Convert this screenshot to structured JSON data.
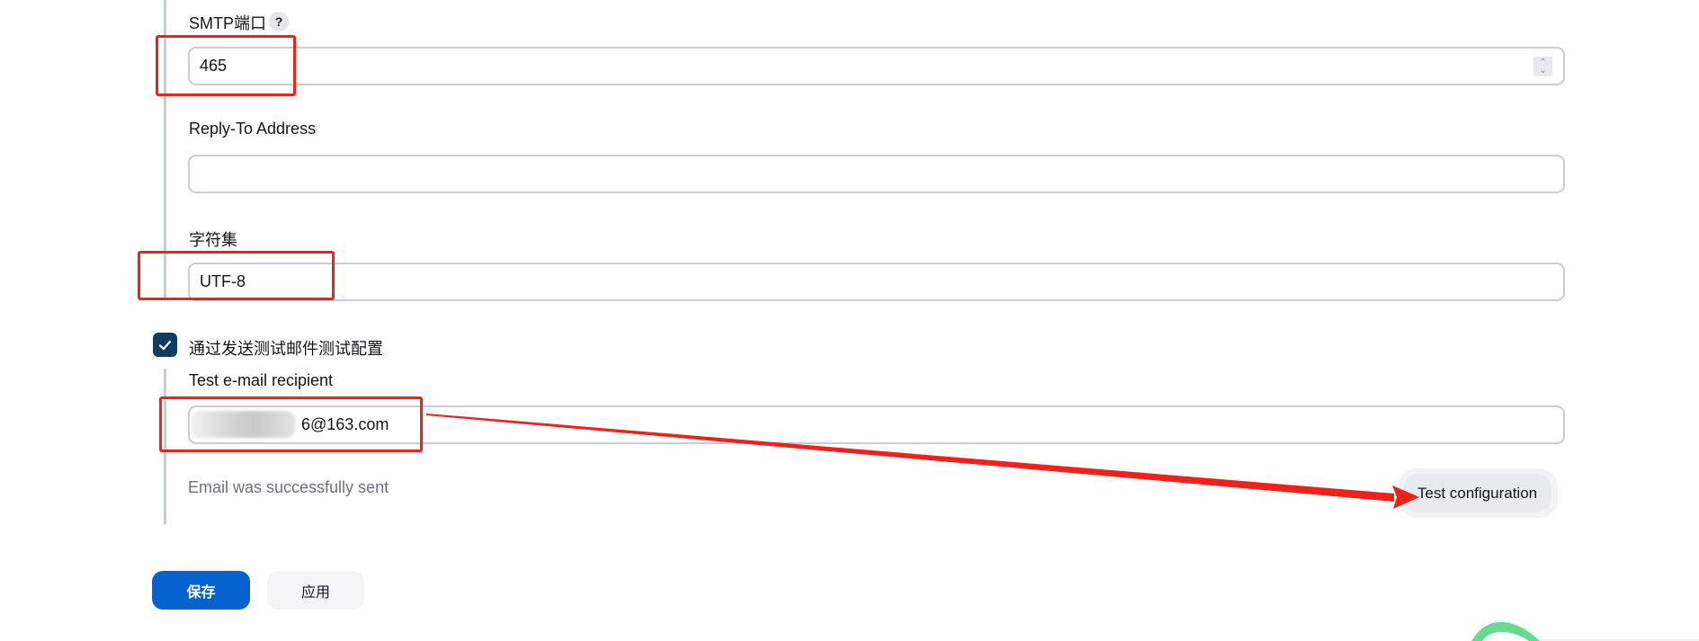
{
  "form": {
    "smtp_port": {
      "label": "SMTP端口",
      "help_icon": "?",
      "value": "465"
    },
    "reply_to": {
      "label": "Reply-To Address",
      "value": ""
    },
    "charset": {
      "label": "字符集",
      "value": "UTF-8"
    },
    "test_by_email": {
      "label": "通过发送测试邮件测试配置",
      "checked": true
    },
    "test_recipient": {
      "label": "Test e-mail recipient",
      "value_visible": "6@163.com",
      "redacted": true
    },
    "status_message": "Email was successfully sent",
    "test_button_label": "Test configuration"
  },
  "actions": {
    "save_label": "保存",
    "apply_label": "应用"
  },
  "annotations": {
    "highlight_color": "#f0201a",
    "highlighted_fields": [
      "smtp_port",
      "charset",
      "test_recipient"
    ],
    "arrow_target": "test_button"
  },
  "colors": {
    "primary": "#0462cf",
    "checkbox": "#0f3d62",
    "status_text": "#6e6e84"
  }
}
